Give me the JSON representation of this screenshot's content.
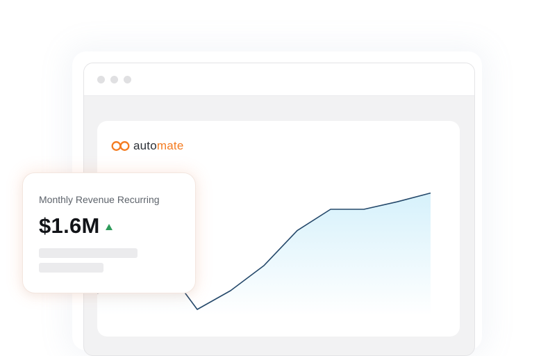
{
  "app": {
    "logo_icon": "infinity-loop-icon",
    "logo_text_part1": "auto",
    "logo_text_part2": "mate",
    "brand_color": "#f47b20"
  },
  "metric_card": {
    "label": "Monthly Revenue Recurring",
    "value": "$1.6M",
    "trend_icon": "triangle-up-icon",
    "trend_color": "#2e9b5a"
  },
  "chart_data": {
    "type": "area",
    "title": "",
    "xlabel": "",
    "ylabel": "",
    "x": [
      0,
      1,
      2,
      3,
      4,
      5,
      6,
      7,
      8,
      9,
      10
    ],
    "series": [
      {
        "values": [
          1.8,
          2.2,
          4.1,
          0.5,
          2.0,
          4.0,
          6.8,
          8.5,
          8.5,
          9.1,
          9.8
        ]
      }
    ],
    "ylim": [
      0,
      10
    ],
    "line_color": "#24486a",
    "fill_color": "#dff4fb",
    "grid": false,
    "legend": "none"
  }
}
